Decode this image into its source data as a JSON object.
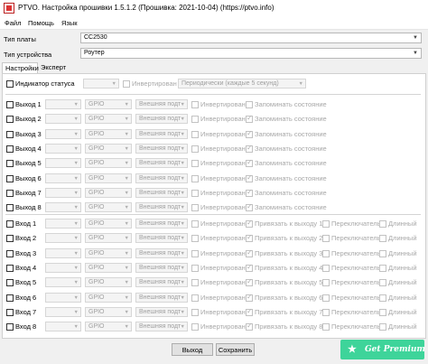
{
  "window": {
    "title": "PTVO. Настройка прошивки 1.5.1.2 (Прошивка: 2021-10-04) (https://ptvo.info)",
    "icon": "app-icon"
  },
  "menu": [
    "Файл",
    "Помощь",
    "Язык"
  ],
  "board": {
    "label": "Тип платы",
    "value": "CC2530"
  },
  "device": {
    "label": "Тип устройства",
    "value": "Роутер"
  },
  "tabs": [
    "Настройки",
    "Эксперт"
  ],
  "status": {
    "label": "Индикатор статуса",
    "pin": "",
    "inverted": "Инвертирован",
    "mode": "Периодически (каждые 5 секунд)"
  },
  "outputs": [
    {
      "label": "Выход 1",
      "pin": "",
      "type": "GPIO",
      "pull": "Внешняя подт",
      "inverted": "Инвертирован",
      "remember": "Запоминать состояние",
      "remember_checked": false
    },
    {
      "label": "Выход 2",
      "pin": "",
      "type": "GPIO",
      "pull": "Внешняя подт",
      "inverted": "Инвертирован",
      "remember": "Запоминать состояние",
      "remember_checked": true
    },
    {
      "label": "Выход 3",
      "pin": "",
      "type": "GPIO",
      "pull": "Внешняя подт",
      "inverted": "Инвертирован",
      "remember": "Запоминать состояние",
      "remember_checked": true
    },
    {
      "label": "Выход 4",
      "pin": "",
      "type": "GPIO",
      "pull": "Внешняя подт",
      "inverted": "Инвертирован",
      "remember": "Запоминать состояние",
      "remember_checked": true
    },
    {
      "label": "Выход 5",
      "pin": "",
      "type": "GPIO",
      "pull": "Внешняя подт",
      "inverted": "Инвертирован",
      "remember": "Запоминать состояние",
      "remember_checked": true
    },
    {
      "label": "Выход 6",
      "pin": "",
      "type": "GPIO",
      "pull": "Внешняя подт",
      "inverted": "Инвертирован",
      "remember": "Запоминать состояние",
      "remember_checked": true
    },
    {
      "label": "Выход 7",
      "pin": "",
      "type": "GPIO",
      "pull": "Внешняя подт",
      "inverted": "Инвертирован",
      "remember": "Запоминать состояние",
      "remember_checked": true
    },
    {
      "label": "Выход 8",
      "pin": "",
      "type": "GPIO",
      "pull": "Внешняя подт",
      "inverted": "Инвертирован",
      "remember": "Запоминать состояние",
      "remember_checked": true
    }
  ],
  "inputs": [
    {
      "label": "Вход 1",
      "pin": "",
      "type": "GPIO",
      "pull": "Внешняя подт",
      "inverted": "Инвертирован",
      "bind": "Привязать к выходу 1",
      "bind_checked": true,
      "switch": "Переключатель",
      "long": "Длинный"
    },
    {
      "label": "Вход 2",
      "pin": "",
      "type": "GPIO",
      "pull": "Внешняя подт",
      "inverted": "Инвертирован",
      "bind": "Привязать к выходу 2",
      "bind_checked": true,
      "switch": "Переключатель",
      "long": "Длинный"
    },
    {
      "label": "Вход 3",
      "pin": "",
      "type": "GPIO",
      "pull": "Внешняя подт",
      "inverted": "Инвертирован",
      "bind": "Привязать к выходу 3",
      "bind_checked": true,
      "switch": "Переключатель",
      "long": "Длинный"
    },
    {
      "label": "Вход 4",
      "pin": "",
      "type": "GPIO",
      "pull": "Внешняя подт",
      "inverted": "Инвертирован",
      "bind": "Привязать к выходу 4",
      "bind_checked": true,
      "switch": "Переключатель",
      "long": "Длинный"
    },
    {
      "label": "Вход 5",
      "pin": "",
      "type": "GPIO",
      "pull": "Внешняя подт",
      "inverted": "Инвертирован",
      "bind": "Привязать к выходу 5",
      "bind_checked": true,
      "switch": "Переключатель",
      "long": "Длинный"
    },
    {
      "label": "Вход 6",
      "pin": "",
      "type": "GPIO",
      "pull": "Внешняя подт",
      "inverted": "Инвертирован",
      "bind": "Привязать к выходу 6",
      "bind_checked": true,
      "switch": "Переключатель",
      "long": "Длинный"
    },
    {
      "label": "Вход 7",
      "pin": "",
      "type": "GPIO",
      "pull": "Внешняя подт",
      "inverted": "Инвертирован",
      "bind": "Привязать к выходу 7",
      "bind_checked": true,
      "switch": "Переключатель",
      "long": "Длинный"
    },
    {
      "label": "Вход 8",
      "pin": "",
      "type": "GPIO",
      "pull": "Внешняя подт",
      "inverted": "Инвертирован",
      "bind": "Привязать к выходу 8",
      "bind_checked": true,
      "switch": "Переключатель",
      "long": "Длинный"
    }
  ],
  "buttons": {
    "exit": "Выход",
    "save": "Сохранить"
  },
  "premium": {
    "label": "Get Premium",
    "icon": "star-icon",
    "color": "#3ed49a"
  }
}
